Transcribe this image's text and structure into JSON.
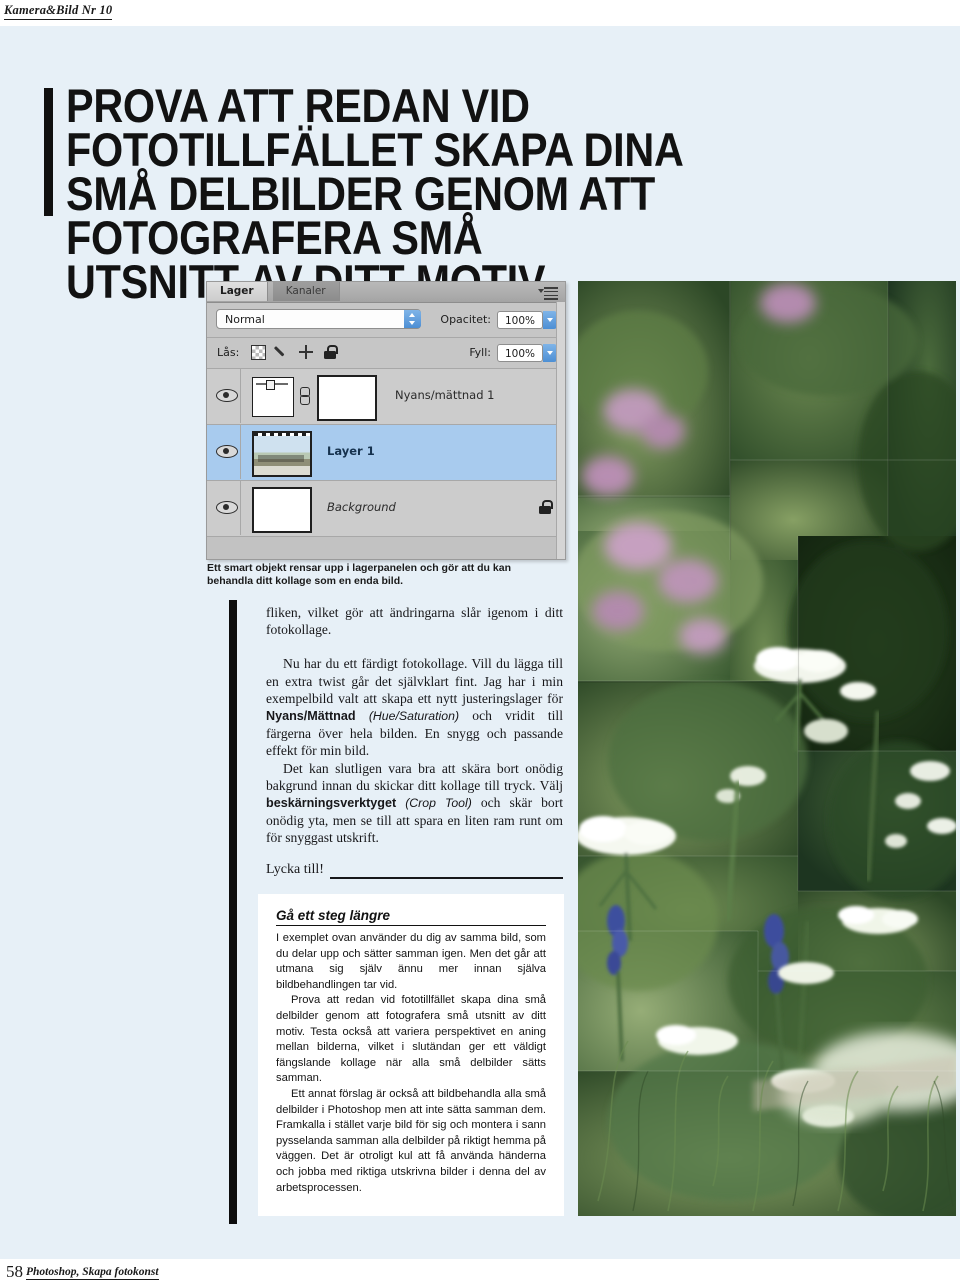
{
  "running_head": "Kamera&Bild Nr 10",
  "headline": "PROVA ATT REDAN VID FOTOTILLFÄLLET SKAPA DINA\nSMÅ DELBILDER GENOM ATT FOTOGRAFERA SMÅ\nUTSNITT AV DITT MOTIV.",
  "photoshop_panel": {
    "tabs": [
      {
        "label": "Lager",
        "active": true
      },
      {
        "label": "Kanaler",
        "active": false
      }
    ],
    "panel_menu_icon": "hamburger-menu-icon",
    "blend_mode": "Normal",
    "opacity_label": "Opacitet:",
    "opacity_value": "100%",
    "lock_label": "Lås:",
    "lock_icons": [
      "checkerboard-transparency-icon",
      "brush-icon",
      "move-icon",
      "lock-icon"
    ],
    "fill_label": "Fyll:",
    "fill_value": "100%",
    "layers": [
      {
        "name": "Nyans/mättnad 1",
        "type": "adjustment",
        "visible": true,
        "selected": false,
        "locked": false
      },
      {
        "name": "Layer 1",
        "type": "smart-object",
        "visible": true,
        "selected": true,
        "locked": false
      },
      {
        "name": "Background",
        "type": "background",
        "visible": true,
        "selected": false,
        "locked": true
      }
    ]
  },
  "panel_caption": "Ett smart objekt rensar upp i lagerpanelen och gör att du kan behandla ditt kollage som en enda bild.",
  "body": {
    "p1": "fliken, vilket gör att ändringarna slår igenom i ditt fotokollage.",
    "p2_a": "Nu har du ett färdigt fotokollage. Vill du lägga till en extra twist går det självklart fint. Jag har i min exempelbild valt att skapa ett nytt justeringslager för ",
    "p2_bold": "Nyans/Mättnad",
    "p2_italic": "(Hue/Saturation)",
    "p2_b": " och vridit till färgerna över hela bilden. En snygg och passande effekt för min bild.",
    "p3_a": "Det kan slutligen vara bra att skära bort onödig bakgrund innan du skickar ditt kollage till tryck. Välj ",
    "p3_bold": "beskärningsverktyget",
    "p3_italic": "(Crop Tool)",
    "p3_b": " och skär bort onödig yta, men se till att spara en liten ram runt om för snyggast utskrift."
  },
  "sign_off": "Lycka till!",
  "sidebox": {
    "title": "Gå ett steg längre",
    "p1": "I exemplet ovan använder du dig av samma bild, som du delar upp och sätter samman igen. Men det går att utmana sig själv ännu mer innan själva bildbehandlingen tar vid.",
    "p2": "Prova att redan vid fototillfället skapa dina små delbilder genom att fotografera små utsnitt av ditt motiv. Testa också att variera perspektivet en aning mellan bilderna, vilket i slutändan ger ett väldigt fängslande kollage när alla små delbilder sätts samman.",
    "p3": "Ett annat förslag är också att bildbehandla alla små delbilder i Photoshop men att inte sätta samman dem. Framkalla i stället varje bild för sig och montera i sann pysselanda samman alla delbilder på riktigt hemma på väggen. Det är otroligt kul att få använda händerna och jobba med riktiga utskrivna bilder i denna del av arbetsprocessen."
  },
  "photo": {
    "alt": "photo-collage-meadow-flowers",
    "description": "Offset tiled collage of a summer meadow with white yarrow umbels, purple and blue wildflowers over blurred green foliage"
  },
  "footer": {
    "page_number": "58",
    "section": "Photoshop, Skapa fotokonst"
  },
  "colors": {
    "page_background": "#e7f0f7",
    "rule_black": "#0d0d0d",
    "sidebox_background": "#ffffff",
    "panel_gray": "#c9c9c9",
    "layer_selected_blue": "#a8cbee"
  }
}
